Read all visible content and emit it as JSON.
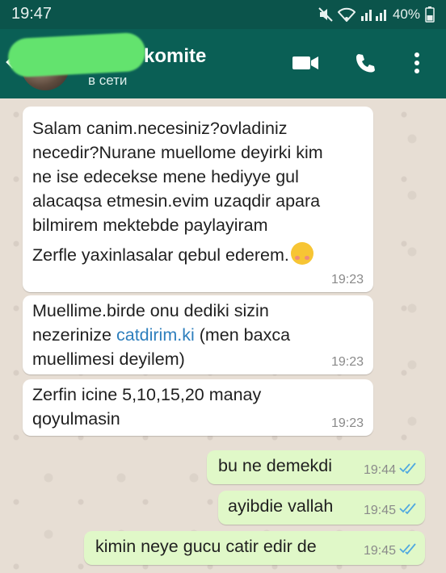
{
  "status_bar": {
    "time": "19:47",
    "battery": "40%"
  },
  "header": {
    "contact_name": "komite",
    "contact_status": "в сети",
    "colors": {
      "app_bar": "#0a5f55",
      "status_bar": "#0b544b"
    }
  },
  "messages": [
    {
      "direction": "incoming",
      "lines": [
        "Salam canim.necesiniz?ovladiniz",
        "necedir?Nurane muellome deyirki kim",
        "ne ise edecekse mene hediyye gul",
        "alacaqsa etmesin.evim uzaqdir apara",
        "bilmirem mektebde paylayiram",
        "Zerfle yaxinlasalar qebul ederem."
      ],
      "time": "19:23"
    },
    {
      "direction": "incoming",
      "line1": "Muellime.birde onu dediki sizin",
      "line2_before": "nezerinize ",
      "line2_link": "catdirim.ki",
      "line2_after": "  (men baxca",
      "line3": "muellimesi deyilem)",
      "time": "19:23"
    },
    {
      "direction": "incoming",
      "lines": [
        "Zerfin icine 5,10,15,20 manay",
        "qoyulmasin"
      ],
      "time": "19:23"
    },
    {
      "direction": "outgoing",
      "text": "bu ne demekdi",
      "time": "19:44"
    },
    {
      "direction": "outgoing",
      "text": "ayibdie vallah",
      "time": "19:45"
    },
    {
      "direction": "outgoing",
      "text": "kimin neye gucu catir edir de",
      "time": "19:45"
    }
  ]
}
